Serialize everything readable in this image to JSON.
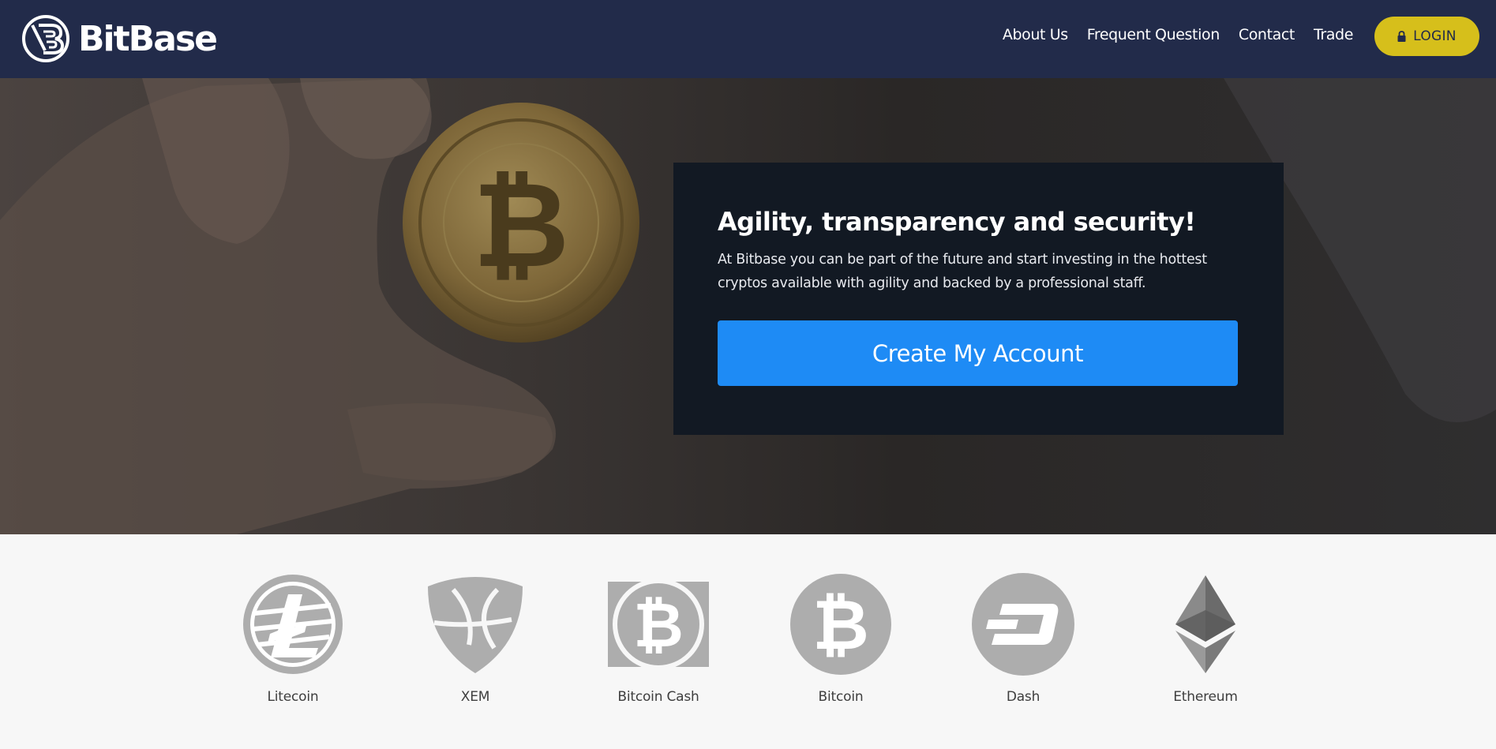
{
  "brand": {
    "name": "BitBase",
    "logo_icon": "bitbase-logo-icon"
  },
  "nav": {
    "items": [
      {
        "label": "About Us"
      },
      {
        "label": "Frequent Question"
      },
      {
        "label": "Contact"
      },
      {
        "label": "Trade"
      }
    ],
    "login": {
      "label": "LOGIN",
      "icon": "lock-icon"
    }
  },
  "hero": {
    "background": "hand-holding-bitcoin-photo",
    "title": "Agility, transparency and security!",
    "text": "At Bitbase you can be part of the future and start investing in the hottest cryptos available with agility and backed by a professional staff.",
    "cta": "Create My Account"
  },
  "coins": [
    {
      "label": "Litecoin",
      "icon": "litecoin-icon"
    },
    {
      "label": "XEM",
      "icon": "xem-icon"
    },
    {
      "label": "Bitcoin Cash",
      "icon": "bitcoin-cash-icon"
    },
    {
      "label": "Bitcoin",
      "icon": "bitcoin-icon"
    },
    {
      "label": "Dash",
      "icon": "dash-icon"
    },
    {
      "label": "Ethereum",
      "icon": "ethereum-icon"
    }
  ],
  "colors": {
    "header": "#222b4a",
    "login_button": "#d6bf1b",
    "cta_button": "#1e8bf5",
    "panel": "#121923",
    "coin_gray": "#adadad"
  }
}
